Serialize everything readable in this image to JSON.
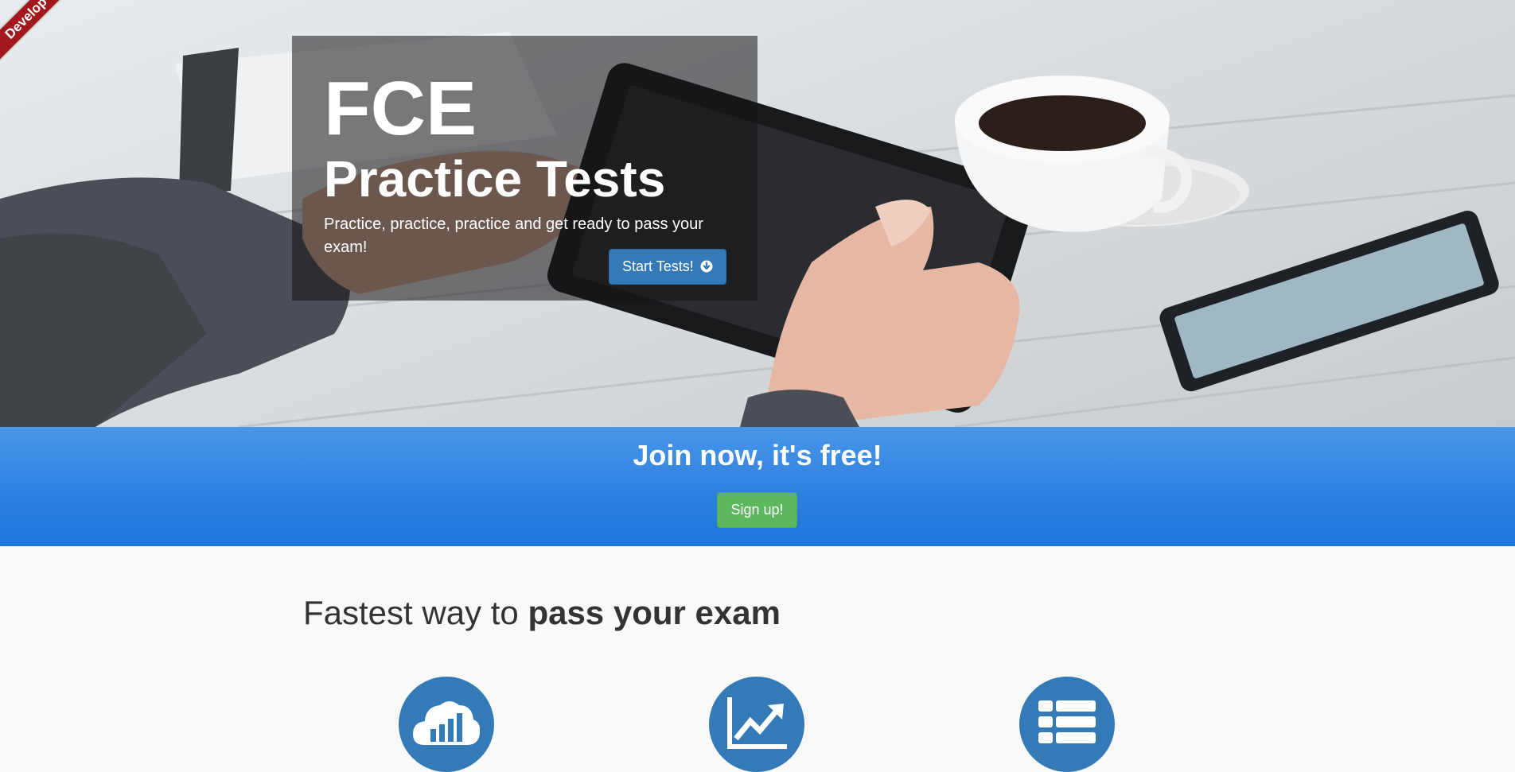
{
  "ribbon": {
    "label": "Develop"
  },
  "hero": {
    "title": "FCE",
    "subtitle": "Practice Tests",
    "description": "Practice, practice, practice and get ready to pass your exam!",
    "start_button": {
      "label": "Start Tests!",
      "icon": "arrow-circle-down-icon"
    }
  },
  "join": {
    "title": "Join now, it's free!",
    "signup_button": {
      "label": "Sign up!"
    }
  },
  "features": {
    "heading_normal": "Fastest way to ",
    "heading_bold": "pass your exam",
    "items": [
      {
        "icon": "cloud-chart-icon"
      },
      {
        "icon": "line-chart-icon"
      },
      {
        "icon": "list-icon"
      }
    ]
  },
  "colors": {
    "primary": "#337ab7",
    "join_band_top": "#4a96e8",
    "join_band_bottom": "#1f76dc",
    "success": "#5cb85c",
    "ribbon": "#a3181c"
  }
}
